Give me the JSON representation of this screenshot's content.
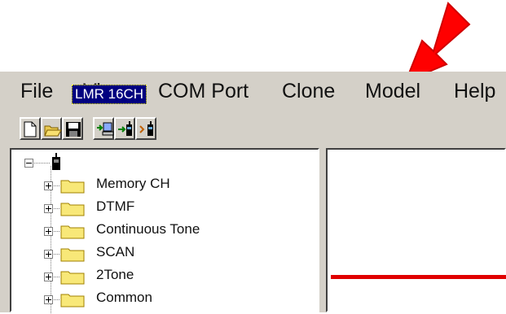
{
  "menu": {
    "file": "File",
    "view": "View",
    "com_port": "COM Port",
    "clone": "Clone",
    "model": "Model",
    "help": "Help"
  },
  "toolbar": {
    "icons": [
      "new-document-icon",
      "open-folder-icon",
      "save-disk-icon",
      "read-from-radio-icon",
      "write-to-radio-icon",
      "clone-radio-icon"
    ]
  },
  "tree": {
    "root": "LMR 16CH",
    "items": [
      "Memory CH",
      "DTMF",
      "Continuous Tone",
      "SCAN",
      "2Tone",
      "Common"
    ]
  },
  "colors": {
    "window_bg": "#d4d0c8",
    "selection": "#000080",
    "annotation_arrow": "#ff0000",
    "right_pane_line": "#e00000"
  }
}
